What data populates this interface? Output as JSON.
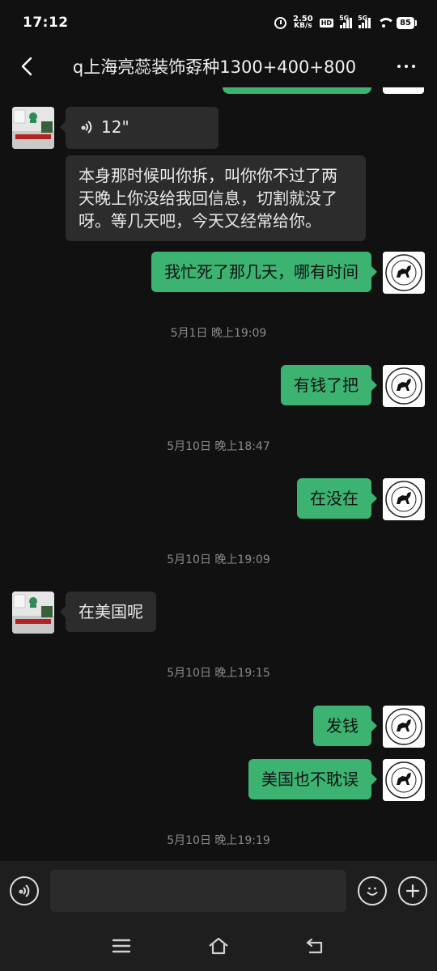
{
  "status": {
    "time": "17:12",
    "speed_value": "2.50",
    "speed_unit": "KB/s",
    "hd_label": "HD",
    "sim1_label": "5G",
    "sim2_label": "5G",
    "battery": "85"
  },
  "header": {
    "title": "q上海亮蕊装饰孬种1300+400+800"
  },
  "messages": [
    {
      "type": "voice",
      "side": "left",
      "duration": "12\""
    },
    {
      "type": "text",
      "side": "left",
      "text": "本身那时候叫你拆，叫你你不过了两天晚上你没给我回信息，切割就没了呀。等几天吧，今天又经常给你。"
    },
    {
      "type": "text",
      "side": "right",
      "text": "我忙死了那几天，哪有时间"
    },
    {
      "type": "time",
      "text": "5月1日 晚上19:09"
    },
    {
      "type": "text",
      "side": "right",
      "text": "有钱了把"
    },
    {
      "type": "time",
      "text": "5月10日 晚上18:47"
    },
    {
      "type": "text",
      "side": "right",
      "text": "在没在"
    },
    {
      "type": "time",
      "text": "5月10日 晚上19:09"
    },
    {
      "type": "text",
      "side": "left",
      "text": "在美国呢"
    },
    {
      "type": "time",
      "text": "5月10日 晚上19:15"
    },
    {
      "type": "text",
      "side": "right",
      "text": "发钱"
    },
    {
      "type": "text",
      "side": "right",
      "text": "美国也不耽误"
    },
    {
      "type": "time",
      "text": "5月10日 晚上19:19"
    }
  ],
  "input": {
    "value": ""
  },
  "colors": {
    "background": "#111111",
    "bubble_sent": "#3cb371",
    "bubble_received": "#2c2c2c",
    "input_bar": "#1e1e1e"
  },
  "icons": {
    "back": "chevron-left-icon",
    "more": "more-dots-icon",
    "voice": "voice-icon",
    "emoji": "emoji-icon",
    "add": "plus-icon",
    "nav_menu": "menu-icon",
    "nav_home": "home-icon",
    "nav_back": "return-icon"
  }
}
